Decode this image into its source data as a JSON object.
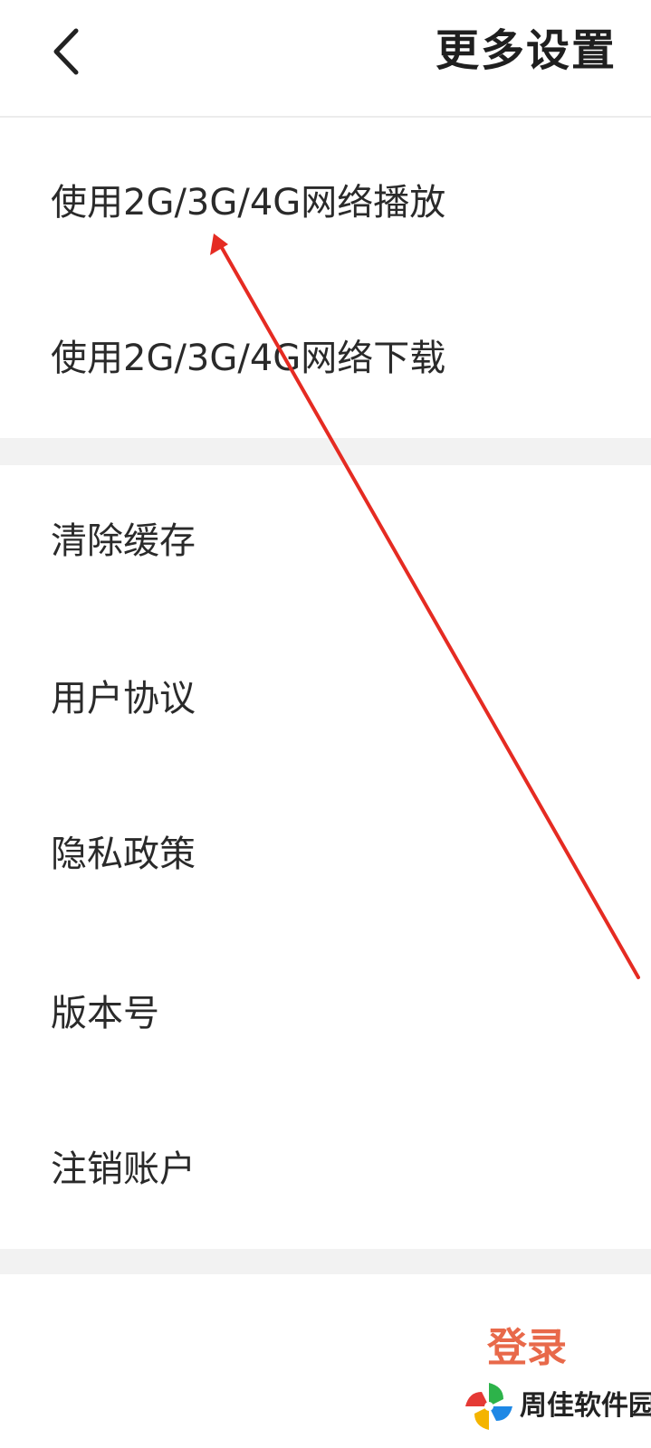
{
  "header": {
    "title": "更多设置"
  },
  "network_section": {
    "items": [
      {
        "label": "使用2G/3G/4G网络播放"
      },
      {
        "label": "使用2G/3G/4G网络下载"
      }
    ]
  },
  "general_section": {
    "items": [
      {
        "label": "清除缓存"
      },
      {
        "label": "用户协议"
      },
      {
        "label": "隐私政策"
      },
      {
        "label": "版本号"
      },
      {
        "label": "注销账户"
      }
    ]
  },
  "footer": {
    "login_label": "登录"
  },
  "watermark": {
    "text": "周佳软件园"
  },
  "colors": {
    "login_accent": "#e8694a",
    "annotation_arrow": "#e52b22",
    "divider": "#f2f2f2"
  },
  "icons": {
    "back": "chevron-left-icon",
    "annotation": "red-arrow-annotation"
  }
}
